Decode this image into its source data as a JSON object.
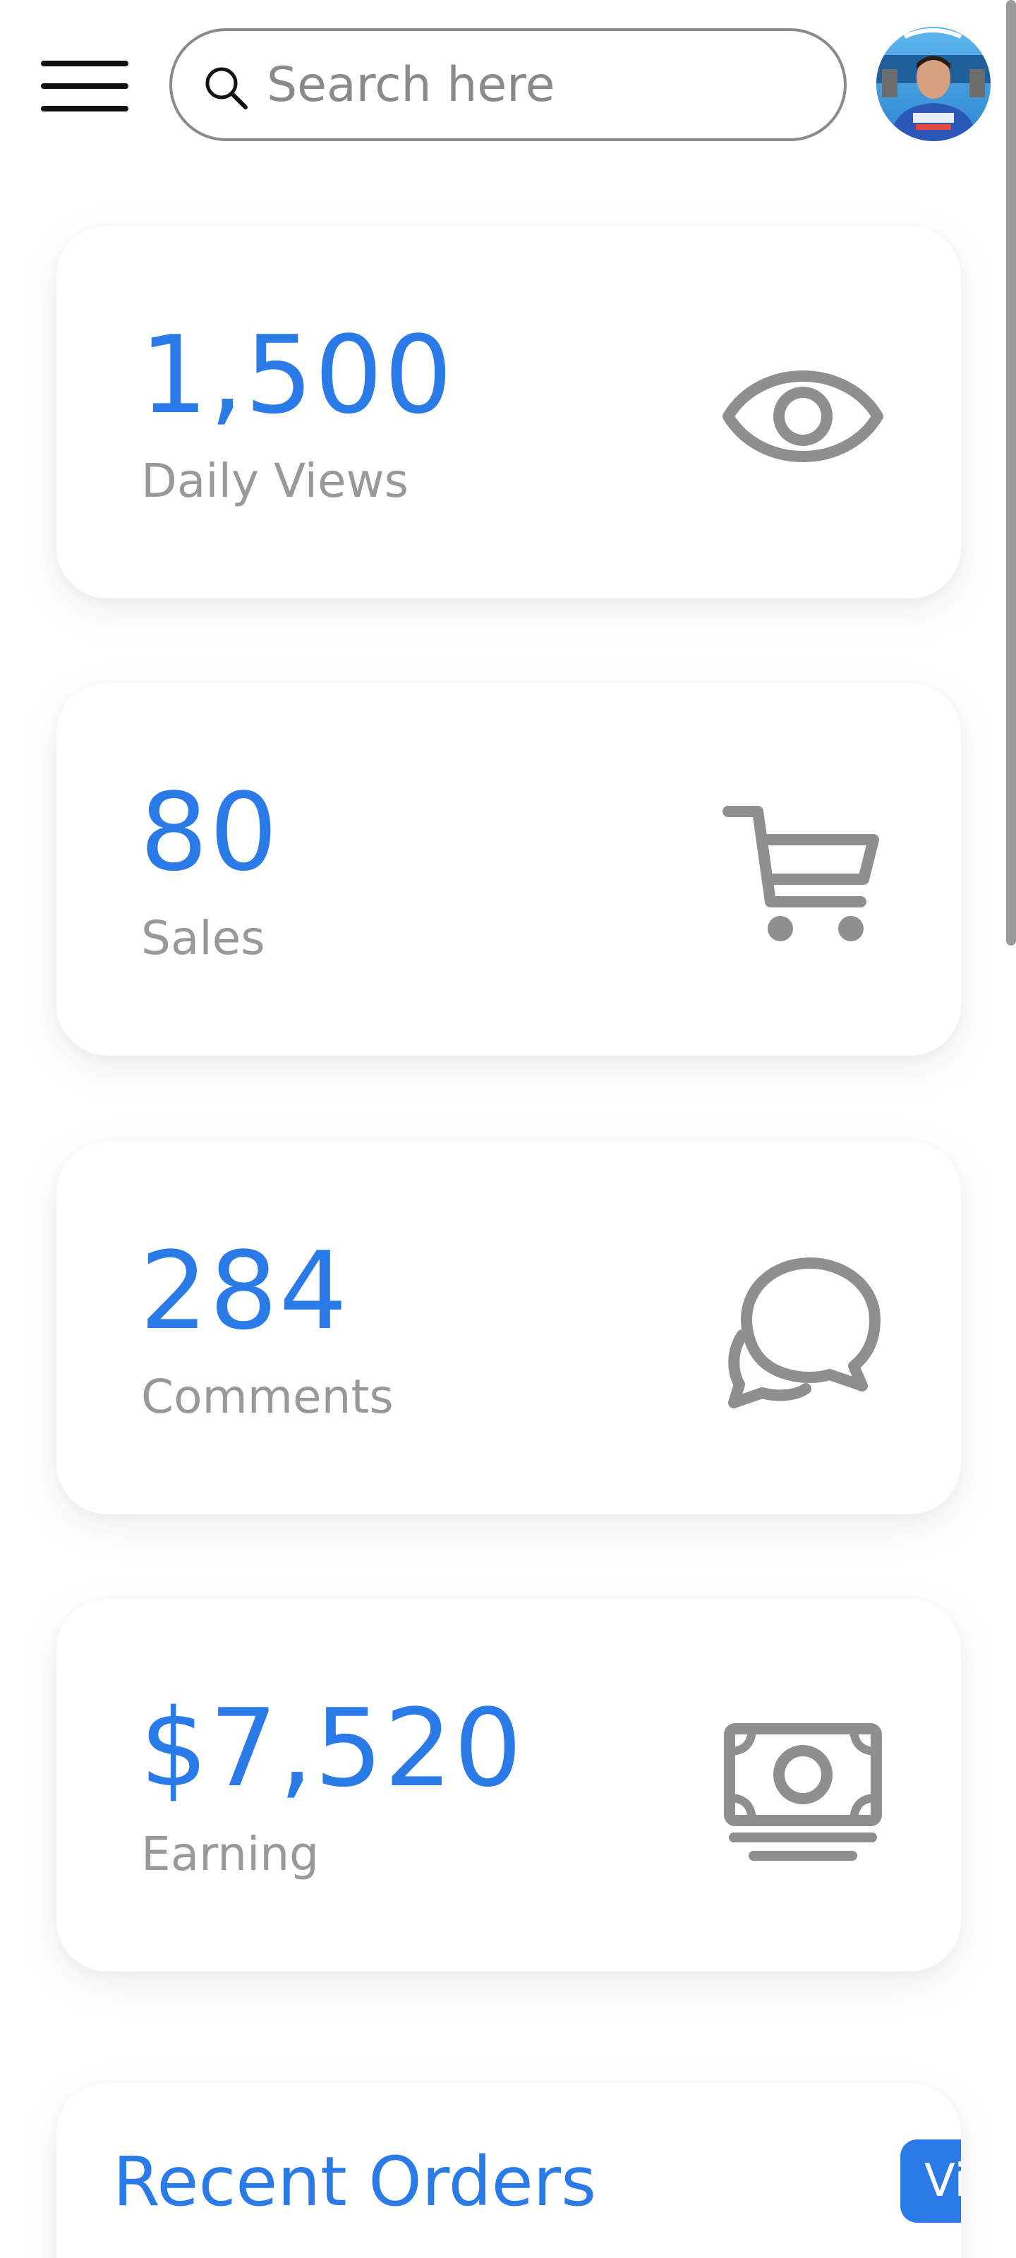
{
  "header": {
    "menu_icon": "hamburger-menu-icon",
    "search": {
      "icon": "search-icon",
      "placeholder": "Search here",
      "value": ""
    },
    "avatar_icon": "user-avatar"
  },
  "cards": [
    {
      "value": "1,500",
      "label": "Daily Views",
      "icon": "eye-icon"
    },
    {
      "value": "80",
      "label": "Sales",
      "icon": "cart-icon"
    },
    {
      "value": "284",
      "label": "Comments",
      "icon": "comments-icon"
    },
    {
      "value": "$7,520",
      "label": "Earning",
      "icon": "money-icon"
    }
  ],
  "recent_orders": {
    "title": "Recent Orders",
    "button_label": "Vi"
  },
  "colors": {
    "accent": "#2a7ae8",
    "label": "#999999",
    "icon": "#8f8f8f",
    "text_dark": "#111111"
  }
}
